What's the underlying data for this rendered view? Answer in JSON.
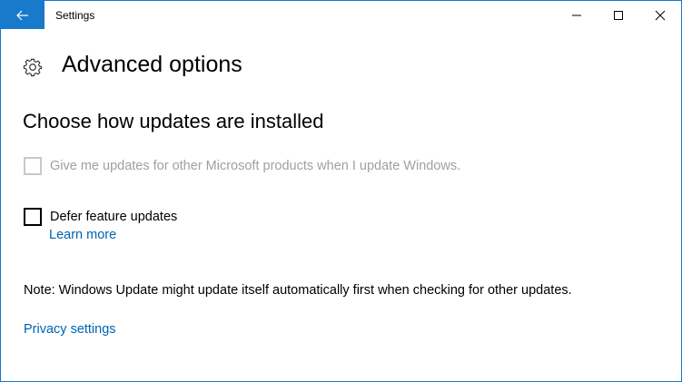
{
  "window": {
    "app_title": "Settings",
    "accent_color": "#1979ca",
    "link_color": "#0063b1",
    "icons": {
      "back": "back-arrow-icon",
      "minimize": "minimize-icon",
      "maximize": "maximize-icon",
      "close": "close-icon"
    }
  },
  "header": {
    "icon": "gear-icon",
    "title": "Advanced options"
  },
  "section": {
    "heading": "Choose how updates are installed"
  },
  "options": [
    {
      "label": "Give me updates for other Microsoft products when I update Windows.",
      "checked": false,
      "disabled": true
    },
    {
      "label": "Defer feature updates",
      "checked": false,
      "disabled": false
    }
  ],
  "learn_more": "Learn more",
  "note": "Note: Windows Update might update itself automatically first when checking for other updates.",
  "privacy_link": "Privacy settings"
}
